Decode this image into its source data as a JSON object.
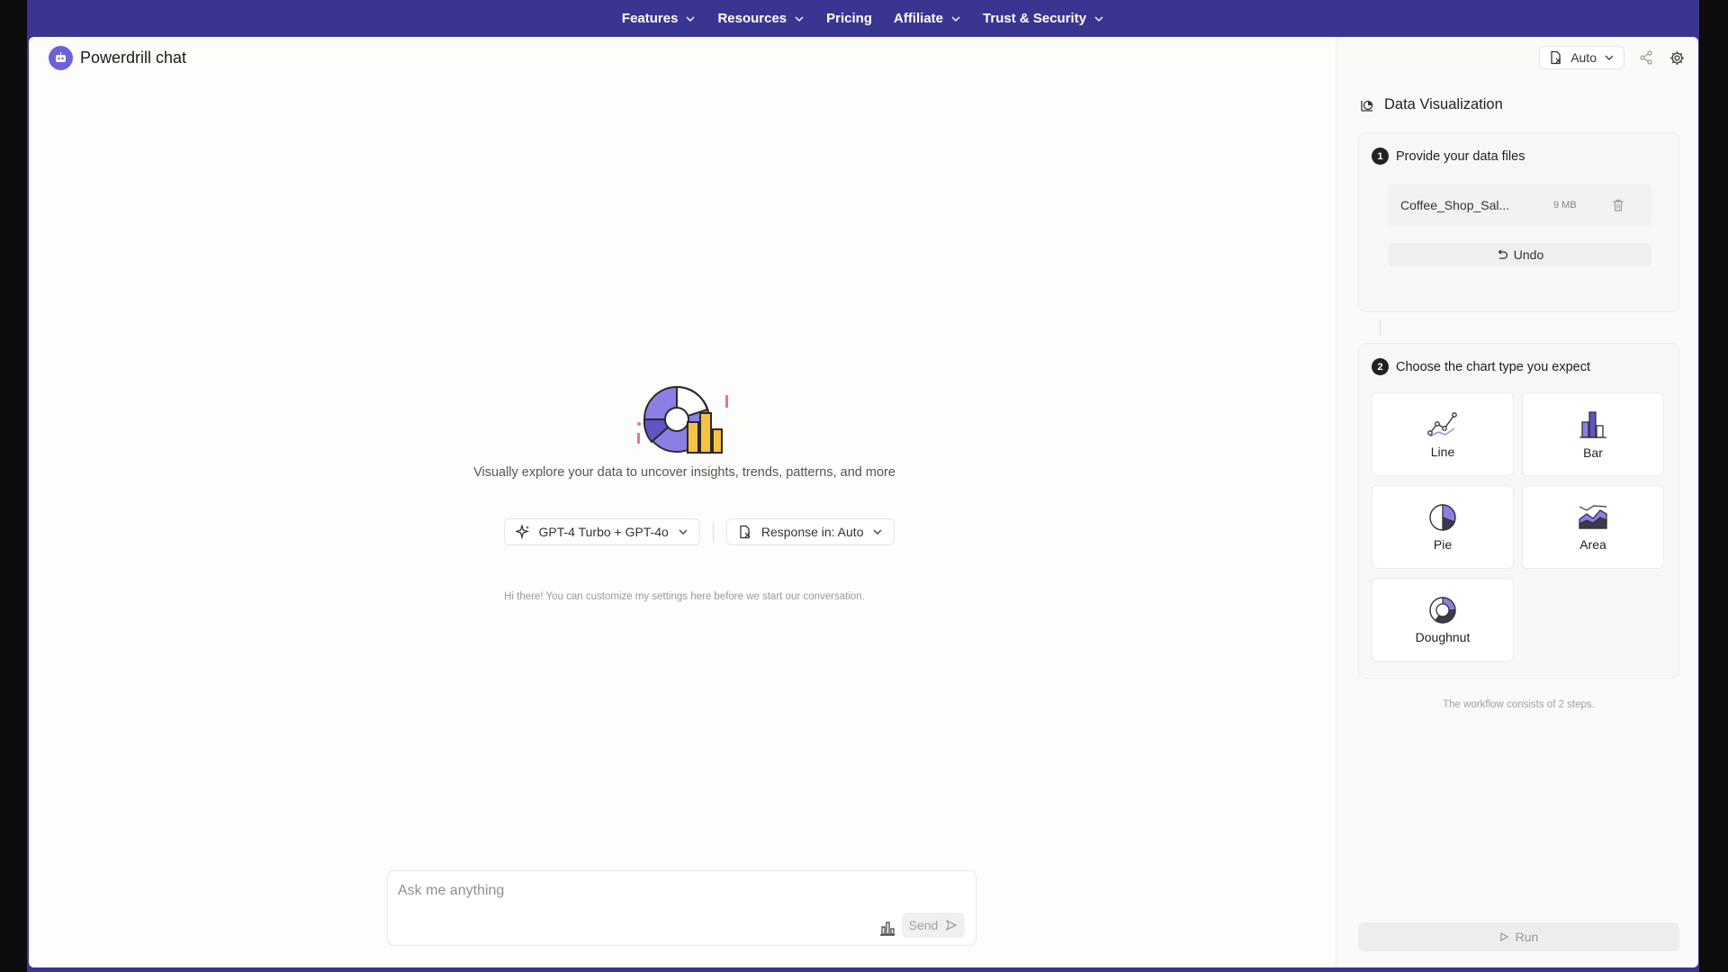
{
  "nav": {
    "items": [
      {
        "label": "Features",
        "dropdown": true
      },
      {
        "label": "Resources",
        "dropdown": true
      },
      {
        "label": "Pricing",
        "dropdown": false
      },
      {
        "label": "Affiliate",
        "dropdown": true
      },
      {
        "label": "Trust & Security",
        "dropdown": true
      }
    ]
  },
  "brand": {
    "name": "Powerdrill chat"
  },
  "main": {
    "hero_text": "Visually explore your data to uncover insights, trends, patterns, and more",
    "model_select": "GPT-4 Turbo + GPT-4o",
    "response_select": "Response in: Auto",
    "hint": "Hi there! You can customize my settings here before we start our conversation.",
    "composer": {
      "placeholder": "Ask me anything",
      "send_label": "Send"
    }
  },
  "panel": {
    "mode_select": "Auto",
    "title": "Data Visualization",
    "step1": {
      "number": "1",
      "title": "Provide your data files",
      "file_name": "Coffee_Shop_Sal...",
      "file_size": "9 MB",
      "undo_label": "Undo"
    },
    "step2": {
      "number": "2",
      "title": "Choose the chart type you expect",
      "chart_types": [
        "Line",
        "Bar",
        "Pie",
        "Area",
        "Doughnut"
      ]
    },
    "workflow_note": "The workflow consists of 2 steps.",
    "run_label": "Run"
  },
  "colors": {
    "nav_bg": "#3a3590",
    "accent": "#6c62d8",
    "chart_purple": "#8b7fe6",
    "chart_yellow": "#f5c243"
  }
}
